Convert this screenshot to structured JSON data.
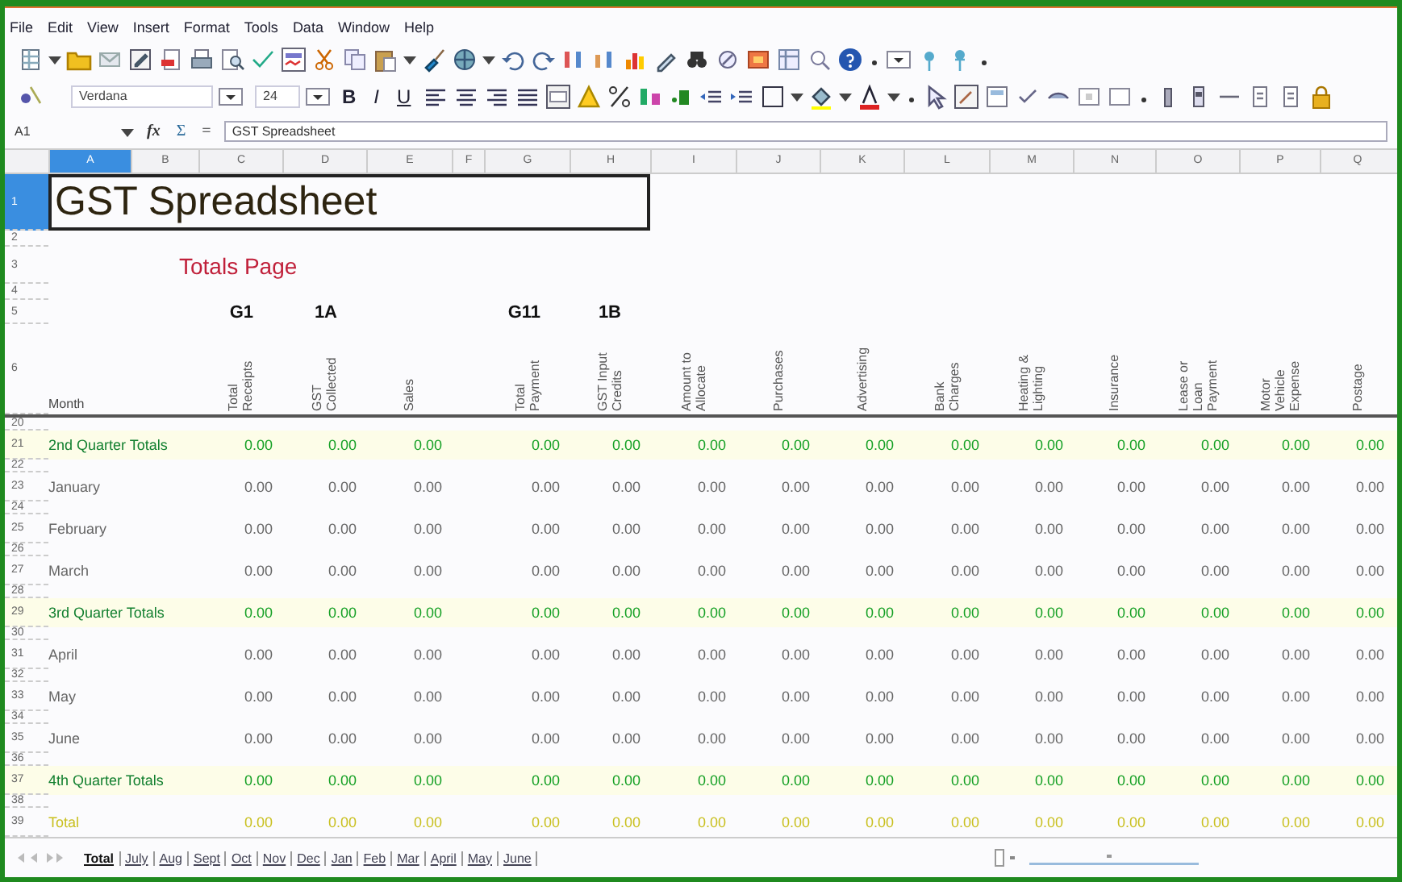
{
  "menu": [
    "File",
    "Edit",
    "View",
    "Insert",
    "Format",
    "Tools",
    "Data",
    "Window",
    "Help"
  ],
  "format_bar": {
    "font_name": "Verdana",
    "font_size": "24",
    "style_buttons": [
      "B",
      "I",
      "U"
    ]
  },
  "formula_bar": {
    "cell_ref": "A1",
    "buttons": [
      "fx",
      "Σ",
      "="
    ],
    "content": "GST Spreadsheet"
  },
  "column_headers": [
    {
      "label": "A",
      "selected": true
    },
    {
      "label": "B",
      "selected": false
    },
    {
      "label": "C",
      "selected": false
    },
    {
      "label": "D",
      "selected": false
    },
    {
      "label": "E",
      "selected": false
    },
    {
      "label": "F",
      "selected": false
    },
    {
      "label": "G",
      "selected": false
    },
    {
      "label": "H",
      "selected": false
    },
    {
      "label": "I",
      "selected": false
    },
    {
      "label": "J",
      "selected": false
    },
    {
      "label": "K",
      "selected": false
    },
    {
      "label": "L",
      "selected": false
    },
    {
      "label": "M",
      "selected": false
    },
    {
      "label": "N",
      "selected": false
    },
    {
      "label": "O",
      "selected": false
    },
    {
      "label": "P",
      "selected": false
    },
    {
      "label": "Q",
      "selected": false
    }
  ],
  "columns": [
    {
      "code": "G1",
      "heading": "Total Receipts"
    },
    {
      "code": "1A",
      "heading": "GST Collected"
    },
    {
      "heading": "Sales"
    },
    {
      "code": "G11",
      "heading": "Total Payment"
    },
    {
      "code": "1B",
      "heading": "GST Input Credits"
    },
    {
      "heading": "Amount to Allocate"
    },
    {
      "heading": "Purchases"
    },
    {
      "heading": "Advertising"
    },
    {
      "heading": "Bank Charges"
    },
    {
      "heading": "Heating & Lighting"
    },
    {
      "heading": "Insurance"
    },
    {
      "heading": "Lease or Loan Payment"
    },
    {
      "heading": "Motor Vehicle Expense"
    },
    {
      "heading": "Postage"
    }
  ],
  "rows": [
    {
      "number": "1",
      "kind": "title",
      "selected": true,
      "text": "GST Spreadsheet"
    },
    {
      "number": "2",
      "kind": "blank",
      "selected": false
    },
    {
      "number": "3",
      "kind": "subtitle",
      "selected": false,
      "text": "Totals Page"
    },
    {
      "number": "4",
      "kind": "blank",
      "selected": false
    },
    {
      "number": "5",
      "kind": "codes",
      "selected": false
    },
    {
      "number": "6",
      "kind": "headings",
      "selected": false,
      "label": "Month"
    },
    {
      "number": "20",
      "kind": "spacer",
      "selected": false
    },
    {
      "number": "21",
      "kind": "quarter",
      "selected": false,
      "label": "2nd Quarter Totals",
      "values": [
        "0.00",
        "0.00",
        "0.00",
        "0.00",
        "0.00",
        "0.00",
        "0.00",
        "0.00",
        "0.00",
        "0.00",
        "0.00",
        "0.00",
        "0.00",
        "0.00"
      ]
    },
    {
      "number": "22",
      "kind": "spacer",
      "selected": false
    },
    {
      "number": "23",
      "kind": "month",
      "selected": false,
      "label": "January",
      "values": [
        "0.00",
        "0.00",
        "0.00",
        "0.00",
        "0.00",
        "0.00",
        "0.00",
        "0.00",
        "0.00",
        "0.00",
        "0.00",
        "0.00",
        "0.00",
        "0.00"
      ]
    },
    {
      "number": "24",
      "kind": "spacer",
      "selected": false
    },
    {
      "number": "25",
      "kind": "month",
      "selected": false,
      "label": "February",
      "values": [
        "0.00",
        "0.00",
        "0.00",
        "0.00",
        "0.00",
        "0.00",
        "0.00",
        "0.00",
        "0.00",
        "0.00",
        "0.00",
        "0.00",
        "0.00",
        "0.00"
      ]
    },
    {
      "number": "26",
      "kind": "spacer",
      "selected": false
    },
    {
      "number": "27",
      "kind": "month",
      "selected": false,
      "label": "March",
      "values": [
        "0.00",
        "0.00",
        "0.00",
        "0.00",
        "0.00",
        "0.00",
        "0.00",
        "0.00",
        "0.00",
        "0.00",
        "0.00",
        "0.00",
        "0.00",
        "0.00"
      ]
    },
    {
      "number": "28",
      "kind": "spacer",
      "selected": false
    },
    {
      "number": "29",
      "kind": "quarter",
      "selected": false,
      "label": "3rd Quarter Totals",
      "values": [
        "0.00",
        "0.00",
        "0.00",
        "0.00",
        "0.00",
        "0.00",
        "0.00",
        "0.00",
        "0.00",
        "0.00",
        "0.00",
        "0.00",
        "0.00",
        "0.00"
      ]
    },
    {
      "number": "30",
      "kind": "spacer",
      "selected": false
    },
    {
      "number": "31",
      "kind": "month",
      "selected": false,
      "label": "April",
      "values": [
        "0.00",
        "0.00",
        "0.00",
        "0.00",
        "0.00",
        "0.00",
        "0.00",
        "0.00",
        "0.00",
        "0.00",
        "0.00",
        "0.00",
        "0.00",
        "0.00"
      ]
    },
    {
      "number": "32",
      "kind": "spacer",
      "selected": false
    },
    {
      "number": "33",
      "kind": "month",
      "selected": false,
      "label": "May",
      "values": [
        "0.00",
        "0.00",
        "0.00",
        "0.00",
        "0.00",
        "0.00",
        "0.00",
        "0.00",
        "0.00",
        "0.00",
        "0.00",
        "0.00",
        "0.00",
        "0.00"
      ]
    },
    {
      "number": "34",
      "kind": "spacer",
      "selected": false
    },
    {
      "number": "35",
      "kind": "month",
      "selected": false,
      "label": "June",
      "values": [
        "0.00",
        "0.00",
        "0.00",
        "0.00",
        "0.00",
        "0.00",
        "0.00",
        "0.00",
        "0.00",
        "0.00",
        "0.00",
        "0.00",
        "0.00",
        "0.00"
      ]
    },
    {
      "number": "36",
      "kind": "spacer",
      "selected": false
    },
    {
      "number": "37",
      "kind": "quarter",
      "selected": false,
      "label": "4th Quarter Totals",
      "values": [
        "0.00",
        "0.00",
        "0.00",
        "0.00",
        "0.00",
        "0.00",
        "0.00",
        "0.00",
        "0.00",
        "0.00",
        "0.00",
        "0.00",
        "0.00",
        "0.00"
      ]
    },
    {
      "number": "38",
      "kind": "spacer",
      "selected": false
    },
    {
      "number": "39",
      "kind": "total",
      "selected": false,
      "label": "Total",
      "values": [
        "0.00",
        "0.00",
        "0.00",
        "0.00",
        "0.00",
        "0.00",
        "0.00",
        "0.00",
        "0.00",
        "0.00",
        "0.00",
        "0.00",
        "0.00",
        "0.00"
      ]
    }
  ],
  "sheet_tabs": [
    {
      "label": "Total",
      "selected": true
    },
    {
      "label": "July",
      "selected": false
    },
    {
      "label": "Aug",
      "selected": false
    },
    {
      "label": "Sept",
      "selected": false
    },
    {
      "label": "Oct",
      "selected": false
    },
    {
      "label": "Nov",
      "selected": false
    },
    {
      "label": "Dec",
      "selected": false
    },
    {
      "label": "Jan",
      "selected": false
    },
    {
      "label": "Feb",
      "selected": false
    },
    {
      "label": "Mar",
      "selected": false
    },
    {
      "label": "April",
      "selected": false
    },
    {
      "label": "May",
      "selected": false
    },
    {
      "label": "June",
      "selected": false
    }
  ]
}
